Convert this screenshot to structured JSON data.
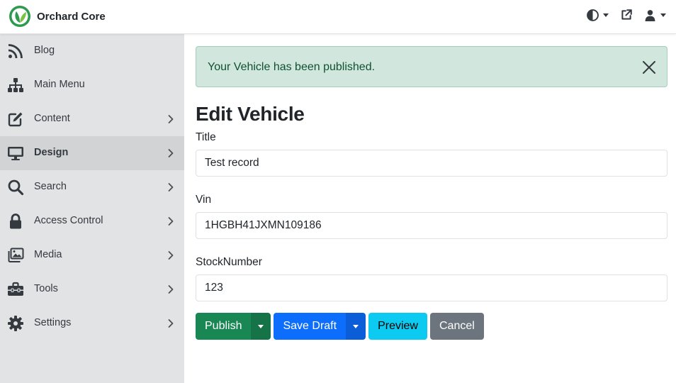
{
  "app": {
    "name": "Orchard Core"
  },
  "colors": {
    "brand": "#2d9b4f",
    "success": "#198754",
    "primary": "#0d6efd",
    "info": "#0dcaf0",
    "secondary": "#6c757d",
    "alert_bg": "#d1e7dd"
  },
  "topbar": {
    "icons": [
      "theme-contrast-icon",
      "external-link-icon",
      "user-icon"
    ]
  },
  "sidebar": {
    "items": [
      {
        "label": "Blog",
        "icon": "rss-icon",
        "has_children": false,
        "active": false
      },
      {
        "label": "Main Menu",
        "icon": "sitemap-icon",
        "has_children": false,
        "active": false
      },
      {
        "label": "Content",
        "icon": "edit-icon",
        "has_children": true,
        "active": false
      },
      {
        "label": "Design",
        "icon": "desktop-icon",
        "has_children": true,
        "active": true
      },
      {
        "label": "Search",
        "icon": "search-icon",
        "has_children": true,
        "active": false
      },
      {
        "label": "Access Control",
        "icon": "lock-icon",
        "has_children": true,
        "active": false
      },
      {
        "label": "Media",
        "icon": "images-icon",
        "has_children": true,
        "active": false
      },
      {
        "label": "Tools",
        "icon": "toolbox-icon",
        "has_children": true,
        "active": false
      },
      {
        "label": "Settings",
        "icon": "gear-icon",
        "has_children": true,
        "active": false
      }
    ]
  },
  "alert": {
    "message": "Your Vehicle has been published."
  },
  "page": {
    "title": "Edit Vehicle"
  },
  "form": {
    "title": {
      "label": "Title",
      "value": "Test record"
    },
    "vin": {
      "label": "Vin",
      "value": "1HGBH41JXMN109186"
    },
    "stock": {
      "label": "StockNumber",
      "value": "123"
    }
  },
  "buttons": {
    "publish": "Publish",
    "save_draft": "Save Draft",
    "preview": "Preview",
    "cancel": "Cancel"
  }
}
